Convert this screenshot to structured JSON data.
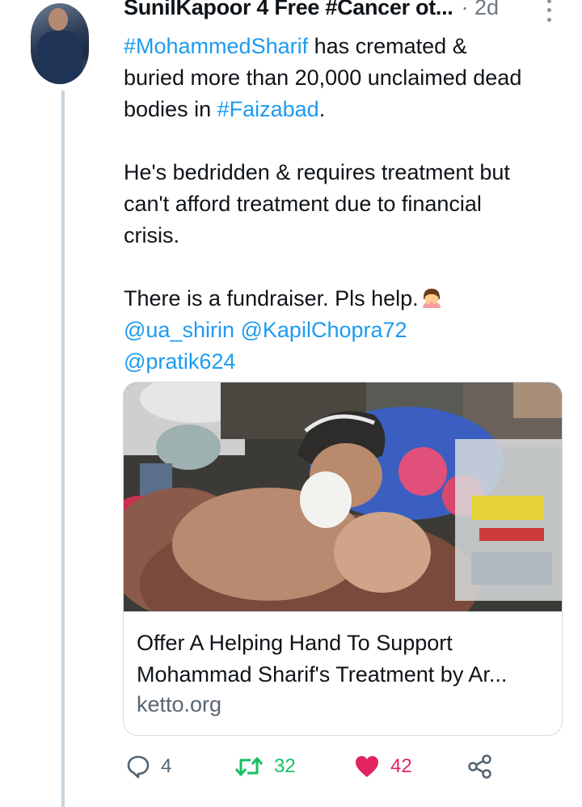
{
  "tweet": {
    "author": {
      "display_name": "SunilKapoor 4 Free #Cancer ot...",
      "avatar_icon": "profile-photo"
    },
    "separator": "·",
    "time": "2d",
    "body": {
      "hashtag_mohammed": "#MohammedSharif",
      "line1_rest": " has cremated &",
      "line2": "buried more than 20,000 unclaimed dead",
      "line3_prefix": "bodies in ",
      "hashtag_faizabad": "#Faizabad",
      "line3_suffix": ".",
      "para2_line1": "He's bedridden & requires treatment but",
      "para2_line2": "can't afford treatment due to financial",
      "para2_line3": "crisis.",
      "para3_line1": "There is a fundraiser. Pls help.",
      "emoji_icon": "person-facepalming-emoji",
      "mention1": "@ua_shirin",
      "mention2": "@KapilChopra72",
      "mention3": "@pratik624"
    },
    "card": {
      "image_icon": "elderly-man-in-bed-photo",
      "title_line1": "Offer A Helping Hand To Support",
      "title_line2": "Mohammad Sharif's Treatment by Ar...",
      "domain": "ketto.org"
    },
    "actions": {
      "reply_count": "4",
      "retweet_count": "32",
      "like_count": "42",
      "reply_icon": "reply-bubble-icon",
      "retweet_icon": "retweet-icon",
      "like_icon": "heart-icon",
      "share_icon": "share-icon"
    },
    "colors": {
      "link": "#1d9bf0",
      "retweet_active": "#17bf63",
      "like_active": "#e0245e",
      "muted": "#536471",
      "thread_line": "#c7d4e0"
    }
  }
}
